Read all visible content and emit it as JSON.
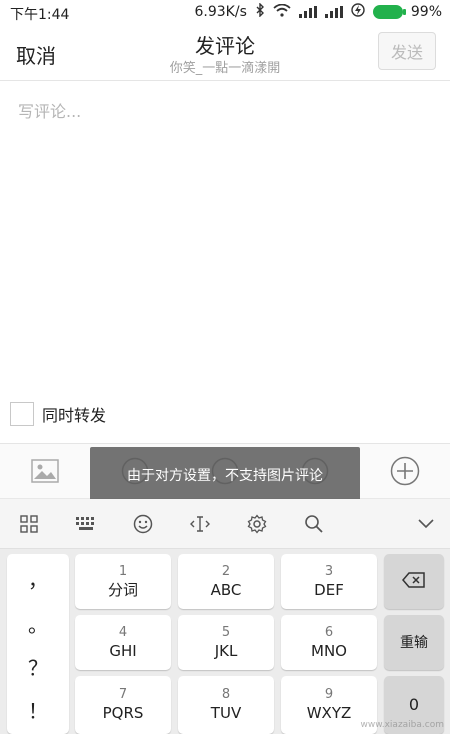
{
  "status_bar": {
    "time": "下午1:44",
    "speed": "6.93K/s",
    "battery": "99%"
  },
  "header": {
    "cancel_label": "取消",
    "title": "发评论",
    "subtitle": "你笑_一點一滴漾開",
    "send_label": "发送"
  },
  "editor": {
    "placeholder": "写评论..."
  },
  "repost": {
    "label": "同时转发",
    "checked": false
  },
  "attachment_bar": {
    "icons": [
      "image-icon",
      "mention-icon",
      "topic-icon",
      "emoji-icon",
      "add-icon"
    ]
  },
  "toast": {
    "text": "由于对方设置，不支持图片评论"
  },
  "keyboard_toolbar": {
    "icons": [
      "grid-icon",
      "keyboard-icon",
      "emoji-icon",
      "cursor-icon",
      "gear-icon",
      "search-icon",
      "chevron-down-icon"
    ]
  },
  "keyboard": {
    "symbols": [
      "，",
      "。",
      "？",
      "！"
    ],
    "keys": [
      {
        "num": "1",
        "label": "分词"
      },
      {
        "num": "2",
        "label": "ABC"
      },
      {
        "num": "3",
        "label": "DEF"
      },
      {
        "num": "4",
        "label": "GHI"
      },
      {
        "num": "5",
        "label": "JKL"
      },
      {
        "num": "6",
        "label": "MNO"
      },
      {
        "num": "7",
        "label": "PQRS"
      },
      {
        "num": "8",
        "label": "TUV"
      },
      {
        "num": "9",
        "label": "WXYZ"
      }
    ],
    "reenter_label": "重输",
    "zero_label": "0"
  },
  "watermark": "www.xiazaiba.com",
  "colors": {
    "battery": "#22b14c",
    "toast_bg": "#5a5a5a"
  }
}
